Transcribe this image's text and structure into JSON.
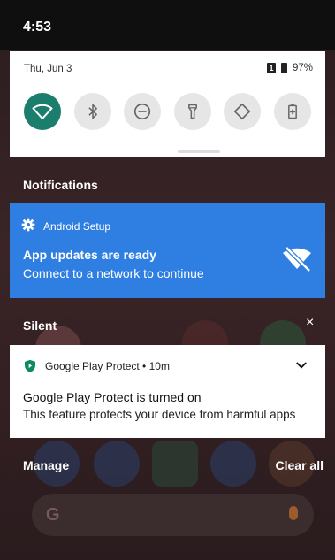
{
  "status_bar": {
    "time": "4:53"
  },
  "quick_settings": {
    "date": "Thu, Jun 3",
    "sim_label": "1",
    "battery_text": "97%",
    "tiles": [
      {
        "name": "wifi",
        "active": true
      },
      {
        "name": "bluetooth",
        "active": false
      },
      {
        "name": "do-not-disturb",
        "active": false
      },
      {
        "name": "flashlight",
        "active": false
      },
      {
        "name": "auto-rotate",
        "active": false
      },
      {
        "name": "battery-saver",
        "active": false
      }
    ]
  },
  "notifications_header": "Notifications",
  "setup_notification": {
    "app": "Android Setup",
    "title": "App updates are ready",
    "text": "Connect to a network to continue",
    "color": "#2f7fe2"
  },
  "silent_section": {
    "label": "Silent",
    "close": "×"
  },
  "play_protect_notification": {
    "app_meta": "Google Play Protect • 10m",
    "title": "Google Play Protect is turned on",
    "text": "This feature protects your device from harmful apps"
  },
  "footer": {
    "manage": "Manage",
    "clear_all": "Clear all"
  },
  "search": {
    "logo": "G"
  }
}
